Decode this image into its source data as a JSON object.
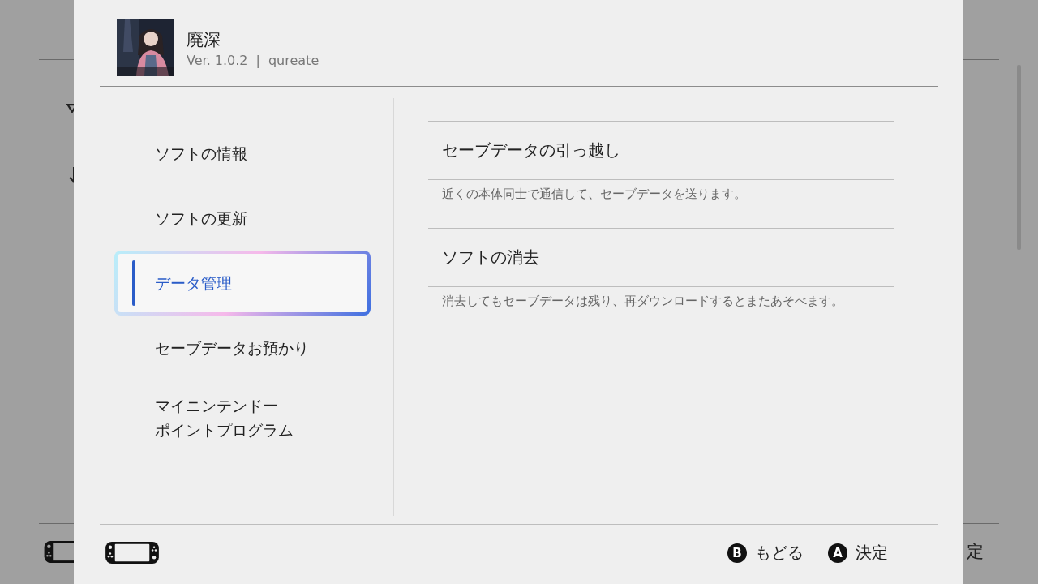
{
  "background": {
    "hint_label": "定"
  },
  "header": {
    "title": "廃深",
    "version": "Ver. 1.0.2",
    "separator": "|",
    "publisher": "qureate"
  },
  "menu": [
    {
      "label": "ソフトの情報",
      "selected": false
    },
    {
      "label": "ソフトの更新",
      "selected": false
    },
    {
      "label": "データ管理",
      "selected": true
    },
    {
      "label": "セーブデータお預かり",
      "selected": false
    },
    {
      "lines": [
        "マイニンテンドー",
        "ポイントプログラム"
      ],
      "selected": false
    }
  ],
  "options": [
    {
      "title": "セーブデータの引っ越し",
      "description": "近くの本体同士で通信して、セーブデータを送ります。"
    },
    {
      "title": "ソフトの消去",
      "description": "消去してもセーブデータは残り、再ダウンロードするとまたあそべます。"
    }
  ],
  "footer": {
    "buttons": [
      {
        "glyph": "B",
        "label": "もどる"
      },
      {
        "glyph": "A",
        "label": "決定"
      }
    ]
  }
}
